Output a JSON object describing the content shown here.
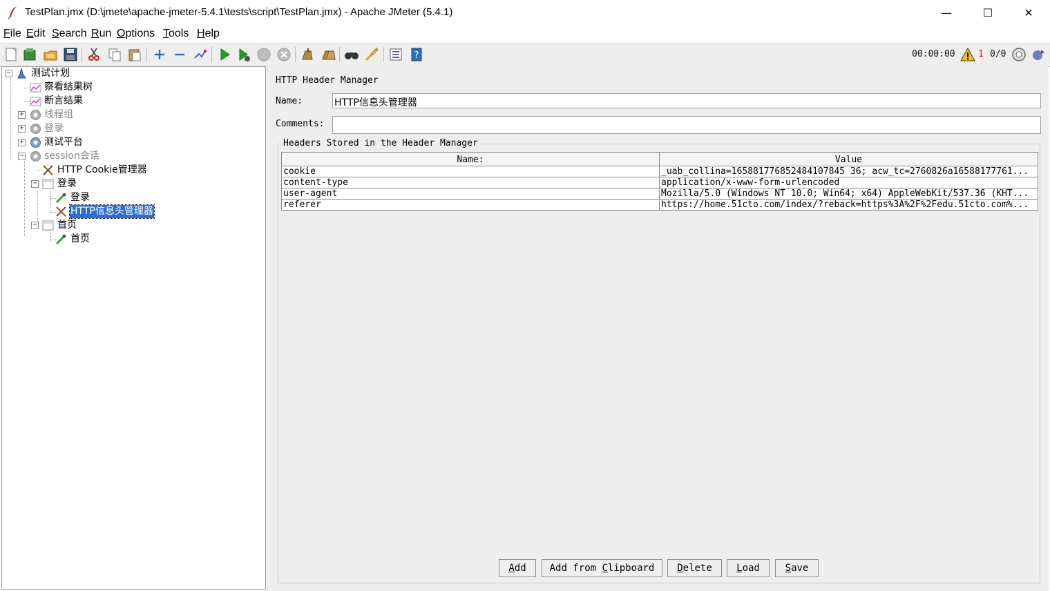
{
  "window": {
    "title": "TestPlan.jmx (D:\\jmete\\apache-jmeter-5.4.1\\tests\\script\\TestPlan.jmx) - Apache JMeter (5.4.1)",
    "minimize_glyph": "—",
    "maximize_glyph": "☐",
    "close_glyph": "✕"
  },
  "menu": {
    "file": {
      "mnemonic": "F",
      "rest": "ile"
    },
    "edit": {
      "mnemonic": "E",
      "rest": "dit"
    },
    "search": {
      "mnemonic": "S",
      "rest": "earch"
    },
    "run": {
      "mnemonic": "R",
      "rest": "un"
    },
    "options": {
      "mnemonic": "O",
      "rest": "ptions"
    },
    "tools": {
      "mnemonic": "T",
      "rest": "ools"
    },
    "help": {
      "mnemonic": "H",
      "rest": "elp"
    }
  },
  "toolbar": {
    "icons": [
      "new-icon",
      "templates-icon",
      "open-icon",
      "save-icon",
      "cut-icon",
      "copy-icon",
      "paste-icon",
      "expand-icon",
      "collapse-icon",
      "toggle-icon",
      "start-icon",
      "start-no-pauses-icon",
      "stop-icon",
      "shutdown-icon",
      "clear-icon",
      "clear-all-icon",
      "search-icon",
      "reset-search-icon",
      "function-helper-icon",
      "help-icon"
    ],
    "elapsed_time": "00:00:00",
    "warning_count": "1",
    "threads": "0/0"
  },
  "tree": {
    "items": [
      {
        "label": "测试计划",
        "icon": "test-plan-icon"
      },
      {
        "label": "察看结果树",
        "icon": "listener-icon"
      },
      {
        "label": "断言结果",
        "icon": "listener-icon"
      },
      {
        "label": "线程组",
        "icon": "thread-group-icon"
      },
      {
        "label": "登录",
        "icon": "thread-group-icon"
      },
      {
        "label": "测试平台",
        "icon": "thread-group-icon"
      },
      {
        "label": "session会话",
        "icon": "thread-group-icon"
      },
      {
        "label": "HTTP Cookie管理器",
        "icon": "config-element-icon"
      },
      {
        "label": "登录",
        "icon": "transaction-controller-icon"
      },
      {
        "label": "登录",
        "icon": "http-sampler-icon"
      },
      {
        "label": "HTTP信息头管理器",
        "icon": "config-element-icon"
      },
      {
        "label": "首页",
        "icon": "transaction-controller-icon"
      },
      {
        "label": "首页",
        "icon": "http-sampler-icon"
      }
    ],
    "expander_plus": "+",
    "expander_minus": "−"
  },
  "panel": {
    "title": "HTTP Header Manager",
    "name_label": "Name:",
    "name_value": "HTTP信息头管理器",
    "comments_label": "Comments:",
    "comments_value": "",
    "group_title": "Headers Stored in the Header Manager",
    "columns": [
      "Name:",
      "Value"
    ],
    "rows": [
      {
        "name": "cookie",
        "value": "_uab_collina=165881776852484107845 36; acw_tc=2760826a16588177761..."
      },
      {
        "name": "content-type",
        "value": "application/x-www-form-urlencoded"
      },
      {
        "name": "user-agent",
        "value": "Mozilla/5.0 (Windows NT 10.0; Win64; x64) AppleWebKit/537.36 (KHT..."
      },
      {
        "name": "referer",
        "value": "https://home.51cto.com/index/?reback=https%3A%2F%2Fedu.51cto.com%..."
      }
    ],
    "buttons": {
      "add": {
        "mnemonic": "A",
        "rest": "dd"
      },
      "add_clipboard": {
        "pre": "Add from ",
        "mnemonic": "C",
        "rest": "lipboard"
      },
      "delete": {
        "mnemonic": "D",
        "rest": "elete"
      },
      "load": {
        "mnemonic": "L",
        "rest": "oad"
      },
      "save": {
        "mnemonic": "S",
        "rest": "ave"
      }
    }
  }
}
